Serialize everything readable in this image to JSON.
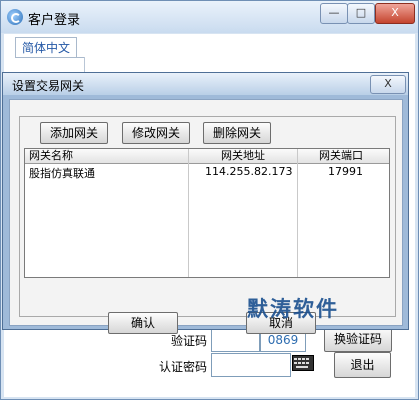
{
  "window": {
    "title": "客户登录",
    "min_label": "—",
    "max_label": "□",
    "close_label": "X"
  },
  "language_tab": "简体中文",
  "login_form": {
    "captcha_label": "验证码",
    "captcha_code": "0869",
    "change_captcha_button": "换验证码",
    "auth_password_label": "认证密码",
    "exit_button": "退出"
  },
  "dialog": {
    "title": "设置交易网关",
    "close_label": "X",
    "toolbar": {
      "add": "添加网关",
      "edit": "修改网关",
      "delete": "删除网关"
    },
    "table": {
      "columns": [
        "网关名称",
        "网关地址",
        "网关端口"
      ],
      "rows": [
        [
          "股指仿真联通",
          "114.255.82.173",
          "17991"
        ]
      ]
    },
    "confirm_button": "确认",
    "cancel_button": "取消"
  },
  "watermark": "默涛软件"
}
